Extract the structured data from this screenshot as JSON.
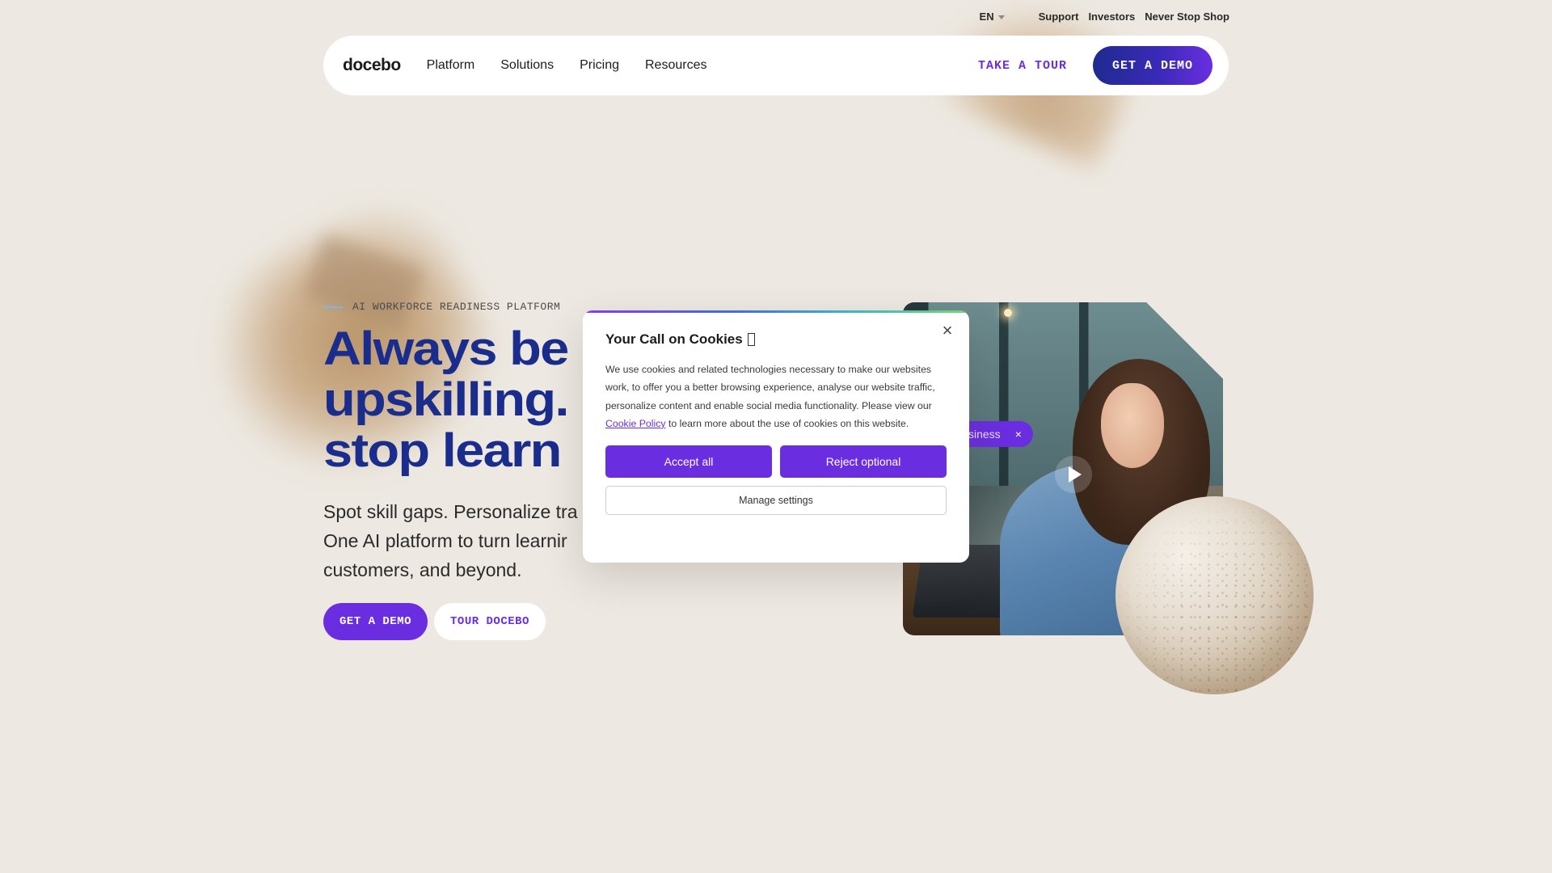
{
  "utility_bar": {
    "language": "EN",
    "links": [
      "Support",
      "Investors",
      "Never Stop Shop"
    ]
  },
  "nav": {
    "logo": "docebo",
    "links": [
      "Platform",
      "Solutions",
      "Pricing",
      "Resources"
    ],
    "take_tour": "TAKE A TOUR",
    "get_demo": "GET A DEMO"
  },
  "hero": {
    "eyebrow": "AI WORKFORCE READINESS PLATFORM",
    "headline_lines": [
      "Always be",
      "upskilling.",
      "stop learn"
    ],
    "subcopy_lines": [
      "Spot skill gaps. Personalize tra",
      "One AI platform to turn learnir",
      "customers, and beyond."
    ],
    "get_demo": "GET A DEMO",
    "tour": "TOUR DOCEBO"
  },
  "video": {
    "tag_label": "siness",
    "tag_close": "×"
  },
  "cookie": {
    "title": "Your Call on Cookies",
    "body_before_link": "We use cookies and related technologies necessary to make our websites work, to offer you a better browsing experience, analyse our website traffic, personalize content and enable social media functionality. Please view our ",
    "link_text": "Cookie Policy",
    "body_after_link": " to learn more about the use of cookies on this website.",
    "accept": "Accept all",
    "reject": "Reject optional",
    "manage": "Manage settings",
    "close": "×"
  },
  "colors": {
    "background": "#ede9e2",
    "brand_purple": "#6a2ee0",
    "headline_blue": "#1a2c8c",
    "nav_demo_gradient_start": "#1f2a8f"
  },
  "icons": {
    "lang_caret": "chevron-down-icon",
    "cookie_close": "close-icon",
    "video_play": "play-icon",
    "tag_close": "close-icon"
  }
}
